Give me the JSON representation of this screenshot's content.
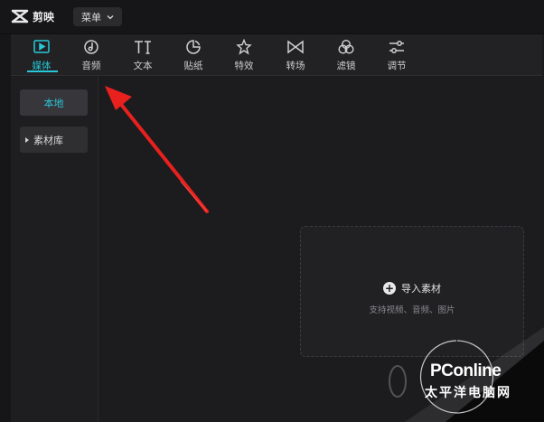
{
  "header": {
    "app_title": "剪映",
    "menu_label": "菜单"
  },
  "toolbar": {
    "items": [
      {
        "label": "媒体",
        "icon": "media-icon",
        "active": true
      },
      {
        "label": "音频",
        "icon": "audio-icon"
      },
      {
        "label": "文本",
        "icon": "text-icon"
      },
      {
        "label": "贴纸",
        "icon": "sticker-icon"
      },
      {
        "label": "特效",
        "icon": "effects-icon"
      },
      {
        "label": "转场",
        "icon": "transition-icon"
      },
      {
        "label": "滤镜",
        "icon": "filter-icon"
      },
      {
        "label": "调节",
        "icon": "adjust-icon"
      }
    ],
    "accent_color": "#27c9d8"
  },
  "sidebar": {
    "local_label": "本地",
    "library_label": "素材库"
  },
  "dropzone": {
    "import_label": "导入素材",
    "support_text": "支持视频、音频、图片"
  },
  "watermark": {
    "brand": "PConline",
    "subtitle": "太平洋电脑网"
  },
  "annotation": {
    "arrow_color": "#e8201e"
  }
}
